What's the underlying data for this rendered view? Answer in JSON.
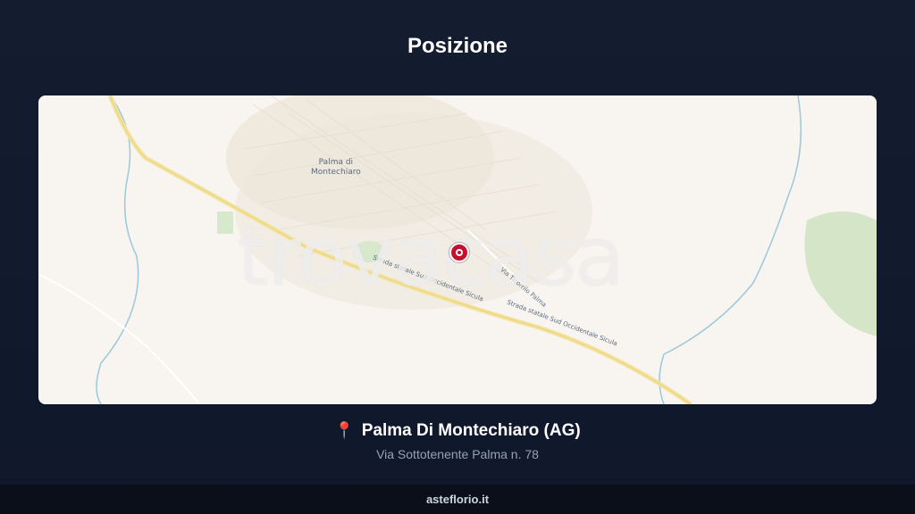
{
  "header": {
    "title": "Posizione"
  },
  "map": {
    "town_label": "Palma di\nMontechiaro",
    "watermark": "trovacasa",
    "road_label_1": "Strada statale Sud Occidentale Sicula",
    "road_label_2": "Strada statale Sud Occidentale Sicula",
    "street_label": "Via Ticorrilo Palma"
  },
  "location": {
    "pin_icon": "📍",
    "name": "Palma Di Montechiaro (AG)",
    "address": "Via Sottotenente Palma n. 78"
  },
  "footer": {
    "site": "asteflorio.it"
  }
}
